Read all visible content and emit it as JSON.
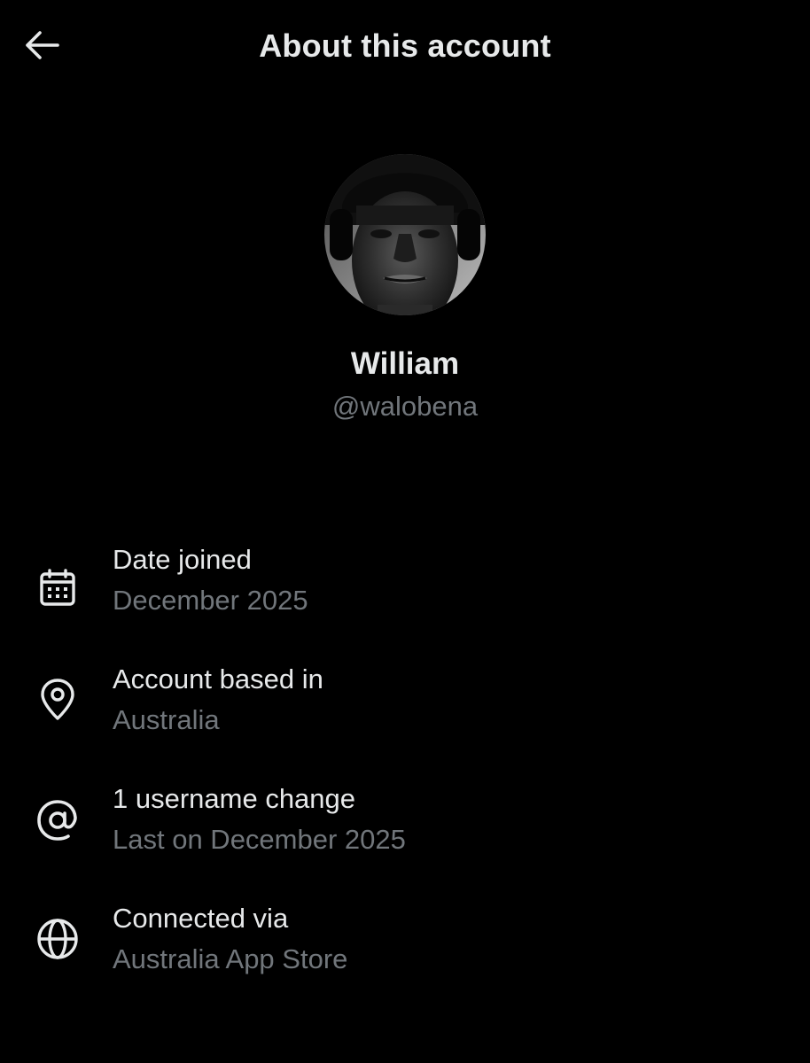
{
  "header": {
    "title": "About this account",
    "back_icon": "arrow-left-icon"
  },
  "profile": {
    "display_name": "William",
    "handle": "@walobena",
    "avatar": "profile-photo"
  },
  "info": {
    "date_joined": {
      "icon": "calendar-icon",
      "label": "Date joined",
      "value": "December 2025"
    },
    "based_in": {
      "icon": "location-pin-icon",
      "label": "Account based in",
      "value": "Australia"
    },
    "username_changes": {
      "icon": "at-sign-icon",
      "label": "1 username change",
      "value": "Last on December 2025"
    },
    "connected_via": {
      "icon": "globe-icon",
      "label": "Connected via",
      "value": "Australia App Store"
    }
  },
  "colors": {
    "background": "#000000",
    "primary_text": "#e7e9ea",
    "secondary_text": "#71767b"
  }
}
